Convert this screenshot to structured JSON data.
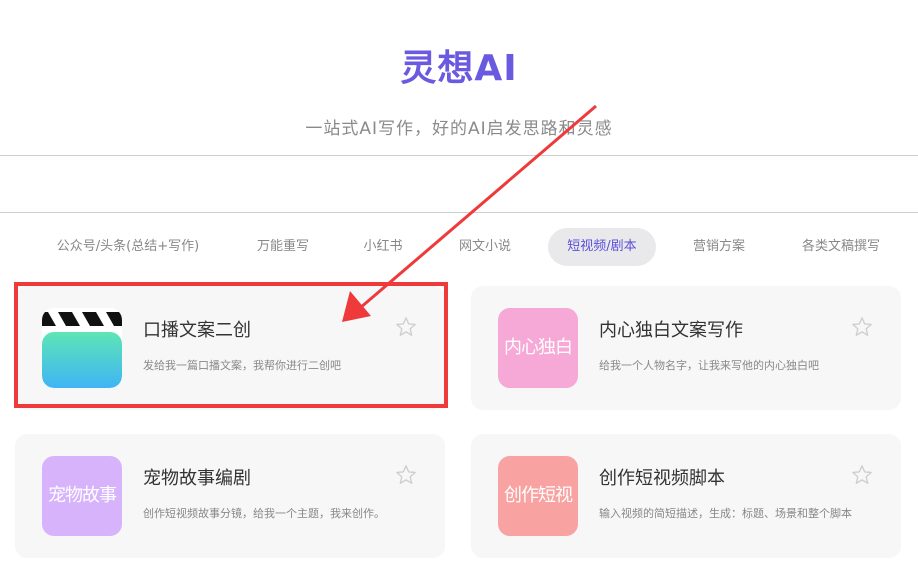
{
  "header": {
    "title": "灵想AI",
    "subtitle": "一站式AI写作，好的AI启发思路和灵感"
  },
  "tabs": [
    {
      "label": "公众号/头条(总结+写作)",
      "active": false
    },
    {
      "label": "万能重写",
      "active": false
    },
    {
      "label": "小红书",
      "active": false
    },
    {
      "label": "网文小说",
      "active": false
    },
    {
      "label": "短视频/剧本",
      "active": true
    },
    {
      "label": "营销方案",
      "active": false
    },
    {
      "label": "各类文稿撰写",
      "active": false
    }
  ],
  "cards": [
    {
      "title": "口播文案二创",
      "desc": "发给我一篇口播文案，我帮你进行二创吧",
      "icon": "clapperboard-icon"
    },
    {
      "title": "内心独白文案写作",
      "desc": "给我一个人物名字，让我来写他的内心独白吧",
      "icon_text": "内心独白",
      "icon_color": "#f6a8d6"
    },
    {
      "title": "宠物故事编剧",
      "desc": "创作短视频故事分镜，给我一个主题，我来创作。",
      "icon_text": "宠物故事",
      "icon_color": "#d6b3fb"
    },
    {
      "title": "创作短视频脚本",
      "desc": "输入视频的简短描述，生成：标题、场景和整个脚本",
      "icon_text": "创作短视",
      "icon_color": "#f8a2a2"
    }
  ],
  "colors": {
    "accent": "#6a5ae0",
    "highlight_annotation": "#ee3a3a"
  }
}
